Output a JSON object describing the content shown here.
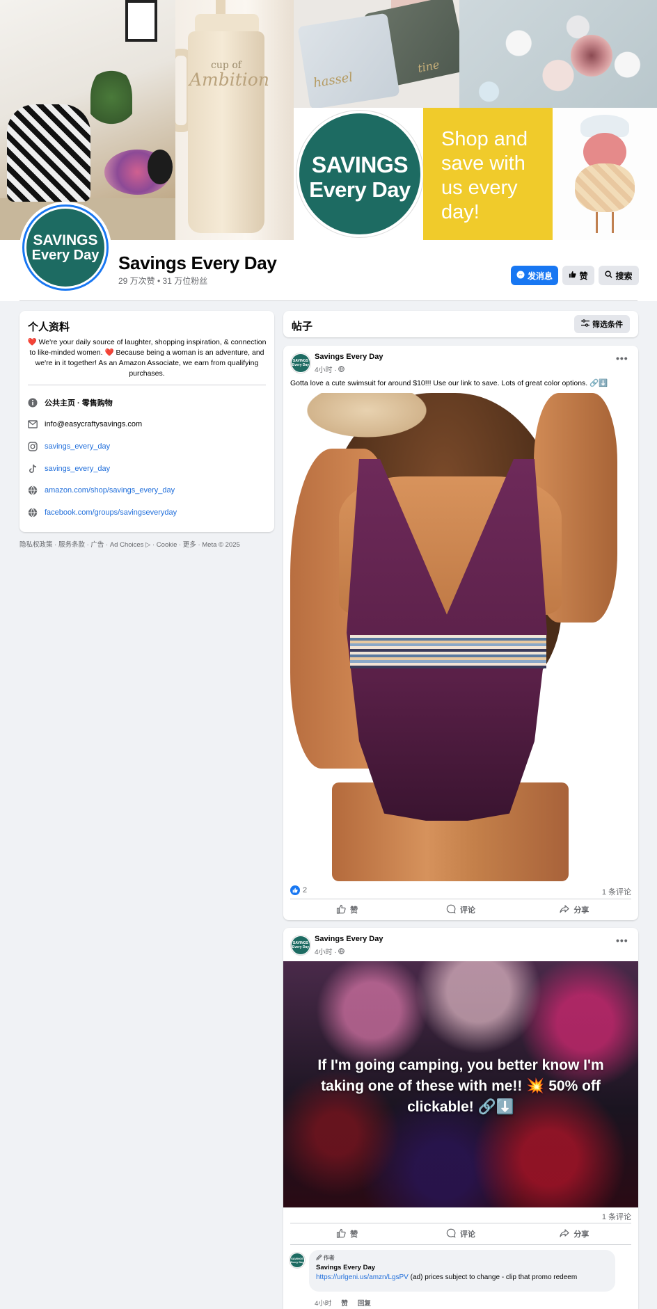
{
  "page": {
    "name": "Savings Every Day",
    "stats": "29 万次赞 • 31 万位粉丝",
    "logo_line1": "SAVINGS",
    "logo_line2": "Every Day"
  },
  "cover": {
    "cup_line1": "cup of",
    "cup_line2": "Ambition",
    "bag_script1": "hassel",
    "bag_script2": "tine",
    "yellow_text": "Shop and save with us every day!"
  },
  "buttons": {
    "message": "发消息",
    "like": "赞",
    "search": "搜索"
  },
  "intro": {
    "title": "个人资料",
    "bio": "❤️ We're your daily source of laughter, shopping inspiration, & connection to like-minded women. ❤️ Because being a woman is an adventure, and we're in it together! As an Amazon Associate, we earn from qualifying purchases.",
    "rows": [
      {
        "icon": "info-icon",
        "label": "公共主页 · 零售购物",
        "link": false
      },
      {
        "icon": "email-icon",
        "label": "info@easycraftysavings.com",
        "link": false
      },
      {
        "icon": "instagram-icon",
        "label": "savings_every_day",
        "link": true
      },
      {
        "icon": "tiktok-icon",
        "label": "savings_every_day",
        "link": true
      },
      {
        "icon": "globe-icon",
        "label": "amazon.com/shop/savings_every_day",
        "link": true
      },
      {
        "icon": "globe-icon",
        "label": "facebook.com/groups/savingseveryday",
        "link": true
      }
    ]
  },
  "footer": "隐私权政策 · 服务条款 · 广告 · Ad Choices ▷ · Cookie · 更多 · Meta © 2025",
  "posts_header": {
    "title": "帖子",
    "filter": "筛选条件"
  },
  "posts": [
    {
      "author": "Savings Every Day",
      "time": "4小时 ·",
      "text": "Gotta love a cute swimsuit for around $10!!! Use our link to save. Lots of great color options. 🔗⬇️",
      "likes": "2",
      "comments": "1 条评论",
      "actions": [
        "赞",
        "评论",
        "分享"
      ]
    },
    {
      "author": "Savings Every Day",
      "time": "4小时 ·",
      "image_text": "If I'm going camping, you better know I'm taking one of these with me!! 💥 50% off clickable! 🔗⬇️",
      "comments": "1 条评论",
      "actions": [
        "赞",
        "评论",
        "分享"
      ],
      "comment": {
        "author_tag": "🖉 作者",
        "author": "Savings Every Day",
        "link": "https://urlgeni.us/amzn/LgsPV",
        "text": " (ad) prices subject to change - clip that promo redeem",
        "time": "4小时",
        "like": "赞",
        "reply": "回复"
      }
    }
  ]
}
